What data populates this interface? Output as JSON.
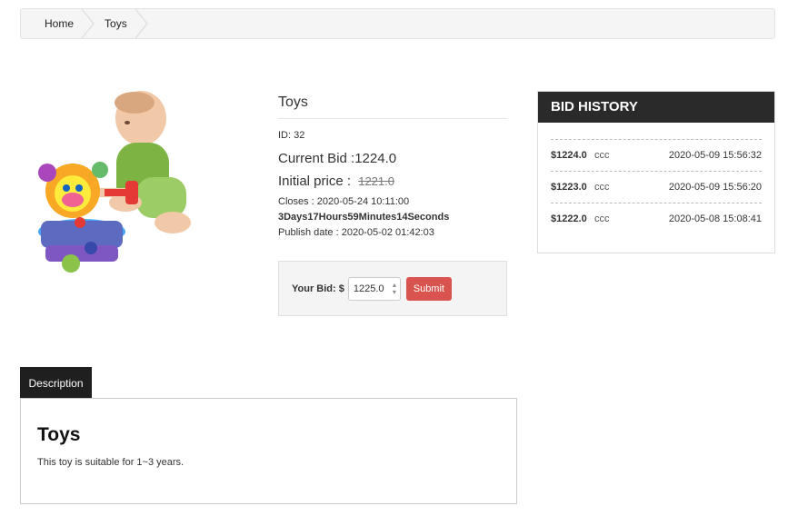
{
  "breadcrumb": {
    "items": [
      "Home",
      "Toys"
    ]
  },
  "product": {
    "title": "Toys",
    "id_text": "ID: 32",
    "current_bid": "Current Bid :1224.0",
    "initial_label": "Initial price :",
    "initial_value": "1221.0",
    "closes": "Closes : 2020-05-24 10:11:00",
    "countdown": "3Days17Hours59Minutes14Seconds",
    "publish": "Publish date : 2020-05-02 01:42:03"
  },
  "bid_form": {
    "label": "Your Bid: $",
    "value": "1225.0",
    "submit_label": "Submit"
  },
  "history": {
    "title": "BID HISTORY",
    "rows": [
      {
        "amount": "$1224.0",
        "user": "ccc",
        "date": "2020-05-09 15:56:32"
      },
      {
        "amount": "$1223.0",
        "user": "ccc",
        "date": "2020-05-09 15:56:20"
      },
      {
        "amount": "$1222.0",
        "user": "ccc",
        "date": "2020-05-08 15:08:41"
      }
    ]
  },
  "description": {
    "tab_label": "Description",
    "title": "Toys",
    "text": "This toy is suitable for 1~3 years."
  },
  "colors": {
    "submit": "#d9534f",
    "dark_header": "#2a2a2a"
  }
}
